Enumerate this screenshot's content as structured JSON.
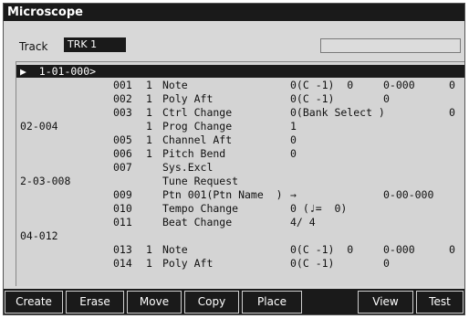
{
  "window": {
    "title": "Microscope"
  },
  "track": {
    "label": "Track",
    "value": "TRK 1"
  },
  "rows": [
    {
      "cols": [
        "▶  1-01-000>",
        "",
        "",
        "",
        "",
        "",
        ""
      ],
      "hl": true
    },
    {
      "cols": [
        "",
        "001",
        "1",
        "Note",
        "0(C -1)  0",
        "0-000",
        "0"
      ]
    },
    {
      "cols": [
        "",
        "002",
        "1",
        "Poly Aft",
        "0(C -1)",
        "0",
        ""
      ]
    },
    {
      "cols": [
        "",
        "003",
        "1",
        "Ctrl Change",
        "0(Bank Select )",
        "",
        "0"
      ]
    },
    {
      "cols": [
        "02-004",
        "",
        "1",
        "Prog Change",
        "1",
        "",
        ""
      ]
    },
    {
      "cols": [
        "",
        "005",
        "1",
        "Channel Aft",
        "0",
        "",
        ""
      ]
    },
    {
      "cols": [
        "",
        "006",
        "1",
        "Pitch Bend",
        "0",
        "",
        ""
      ]
    },
    {
      "cols": [
        "",
        "007",
        "",
        "Sys.Excl",
        "",
        "",
        ""
      ]
    },
    {
      "cols": [
        "2-03-008",
        "",
        "",
        "Tune Request",
        "",
        "",
        ""
      ]
    },
    {
      "cols": [
        "",
        "009",
        "",
        "Ptn 001(Ptn Name  )",
        "→",
        "0-00-000",
        ""
      ]
    },
    {
      "cols": [
        "",
        "010",
        "",
        "Tempo Change",
        "0 (♩=  0)",
        "",
        ""
      ]
    },
    {
      "cols": [
        "",
        "011",
        "",
        "Beat Change",
        "4/ 4",
        "",
        ""
      ]
    },
    {
      "cols": [
        "04-012",
        "",
        "",
        "",
        "",
        "",
        ""
      ]
    },
    {
      "cols": [
        "",
        "013",
        "1",
        "Note",
        "0(C -1)  0",
        "0-000",
        "0"
      ]
    },
    {
      "cols": [
        "",
        "014",
        "1",
        "Poly Aft",
        "0(C -1)",
        "0",
        ""
      ]
    }
  ],
  "buttons": [
    "Create",
    "Erase",
    "Move",
    "Copy",
    "Place",
    "View",
    "Test"
  ]
}
